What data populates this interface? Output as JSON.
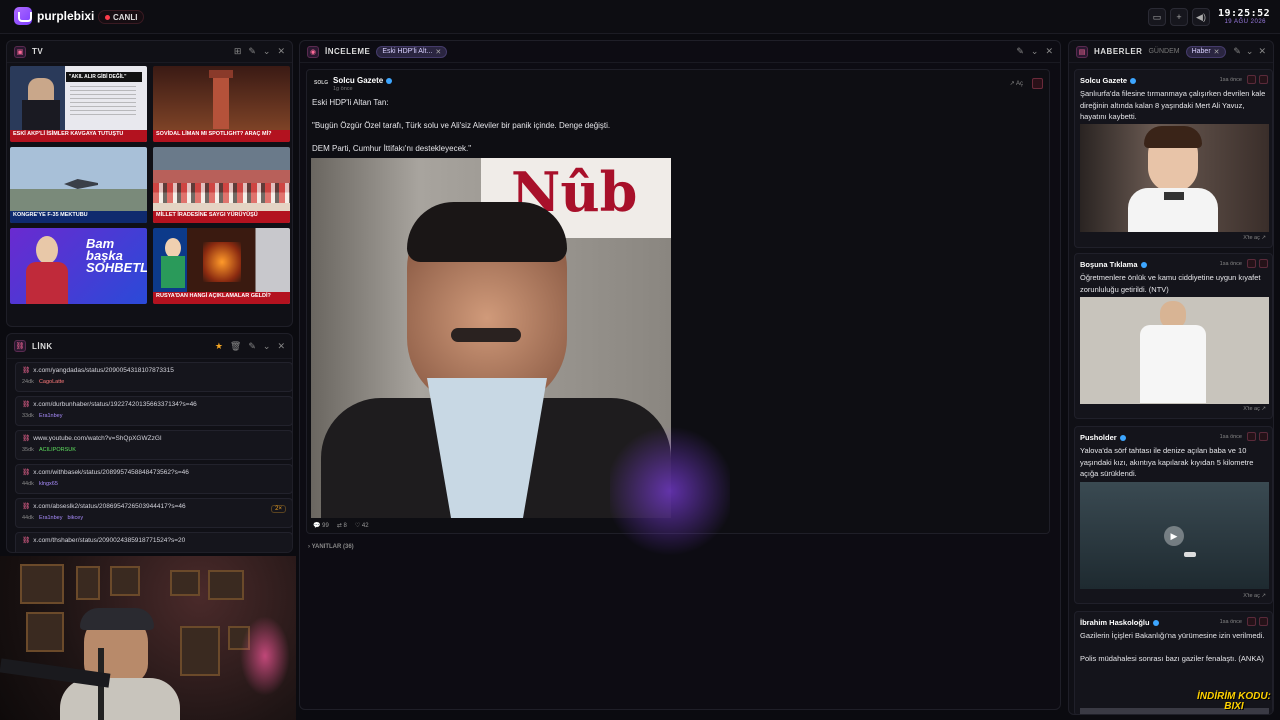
{
  "topbar": {
    "brand": "purplebixi",
    "live_label": "CANLI",
    "time": "19:25:52",
    "date": "19 AĞU 2026",
    "buttons": [
      "window-icon",
      "plus-icon",
      "volume-icon"
    ]
  },
  "tv": {
    "title": "TV",
    "channels": [
      {
        "headline": "ESKİ AKP'Lİ İSİMLER KAVGAYA TUTUŞTU",
        "quote": "\"AKIL ALIR GİBİ DEĞİL\""
      },
      {
        "headline": "SOVİDAL LİMAN MI SPOTLIGHT? ARAÇ Mİ?",
        "quote": ""
      },
      {
        "headline": "KONGRE'YE F-35 MEKTUBU",
        "quote": ""
      },
      {
        "headline": "MİLLET İRADESİNE SAYGI YÜRÜYÜŞÜ",
        "quote": ""
      },
      {
        "headline": "Bam başka SOHBETLER",
        "quote": ""
      },
      {
        "headline": "RUSYA'DAN HANGİ AÇIKLAMALAR GELDİ?",
        "quote": ""
      }
    ]
  },
  "link": {
    "title": "LİNK",
    "items": [
      {
        "url": "x.com/yangdadas/status/2090054318107873315",
        "time": "24dk",
        "user": "CagoLatte",
        "user_color": "#ff7a7a",
        "user2": "",
        "badge": ""
      },
      {
        "url": "x.com/durbunhaber/status/1922742013566337134?s=46",
        "time": "33dk",
        "user": "Era1nbey",
        "user_color": "#a78bfa",
        "user2": "",
        "badge": ""
      },
      {
        "url": "www.youtube.com/watch?v=ShQpXGWZzGI",
        "time": "35dk",
        "user": "ACILIPORSUK",
        "user_color": "#5ee05e",
        "user2": "",
        "badge": ""
      },
      {
        "url": "x.com/withbasek/status/2089957458848473562?s=46",
        "time": "44dk",
        "user": "klngx65",
        "user_color": "#a78bfa",
        "user2": "",
        "badge": ""
      },
      {
        "url": "x.com/abseslk2/status/2086954726503944417?s=46",
        "time": "44dk",
        "user": "Era1nbey",
        "user_color": "#a78bfa",
        "user2": "bikcey",
        "badge": "2×"
      },
      {
        "url": "x.com/thshaber/status/2090024385918771524?s=20",
        "time": "",
        "user": "",
        "user_color": "#a78bfa",
        "user2": "",
        "badge": ""
      }
    ]
  },
  "inceleme": {
    "title": "İNCELEME",
    "chip": "Eski HDP'li Alt...",
    "post": {
      "source_logo": "SOLG",
      "author": "Solcu Gazete",
      "time": "1g önce",
      "open_label": "Aç",
      "lines": [
        "Eski HDP'li Altan Tan:",
        "",
        "\"Bugün Özgür Özel tarafı, Türk solu ve Ali'siz Aleviler bir panik içinde. Denge değişti.",
        "",
        "DEM Parti, Cumhur İttifakı'nı destekleyecek.\""
      ],
      "image_caption": "Nûb",
      "replies_count": "99",
      "retweets_count": "8",
      "likes_count": "42"
    },
    "replies_label": "YANITLAR (36)"
  },
  "haberler": {
    "title": "HABERLER",
    "tab_gundem": "GÜNDEM",
    "chip": "Haber",
    "cards": [
      {
        "author": "Solcu Gazete",
        "time": "1sa önce",
        "text": "Şanlıurfa'da filesine tırmanmaya çalışırken devrilen kale direğinin altında kalan 8 yaşındaki Mert Ali Yavuz, hayatını kaybetti.",
        "open": "X'te aç"
      },
      {
        "author": "Boşuna Tıklama",
        "time": "1sa önce",
        "text": "Öğretmenlere önlük ve kamu ciddiyetine uygun kıyafet zorunluluğu getirildi. (NTV)",
        "open": "X'te aç"
      },
      {
        "author": "Pusholder",
        "time": "1sa önce",
        "text": "Yalova'da sörf tahtası ile denize açılan baba ve 10 yaşındaki kızı, akıntıya kapılarak kıyıdan 5 kilometre açığa sürüklendi.",
        "open": "X'te aç"
      },
      {
        "author": "İbrahim Haskoloğlu",
        "time": "1sa önce",
        "text": "Gazilerin İçişleri Bakanlığı'na yürümesine izin verilmedi.",
        "text2": "Polis müdahalesi sonrası bazı gaziler fenalaştı. (ANKA)",
        "open": ""
      }
    ]
  },
  "overlay": {
    "promo_line1": "İNDİRİM KODU:",
    "promo_line2": "BIXI"
  },
  "colors": {
    "accent": "#8b5cf6",
    "live": "#ff3b4a",
    "verified": "#3da6ff",
    "bg": "#0b0b10"
  }
}
